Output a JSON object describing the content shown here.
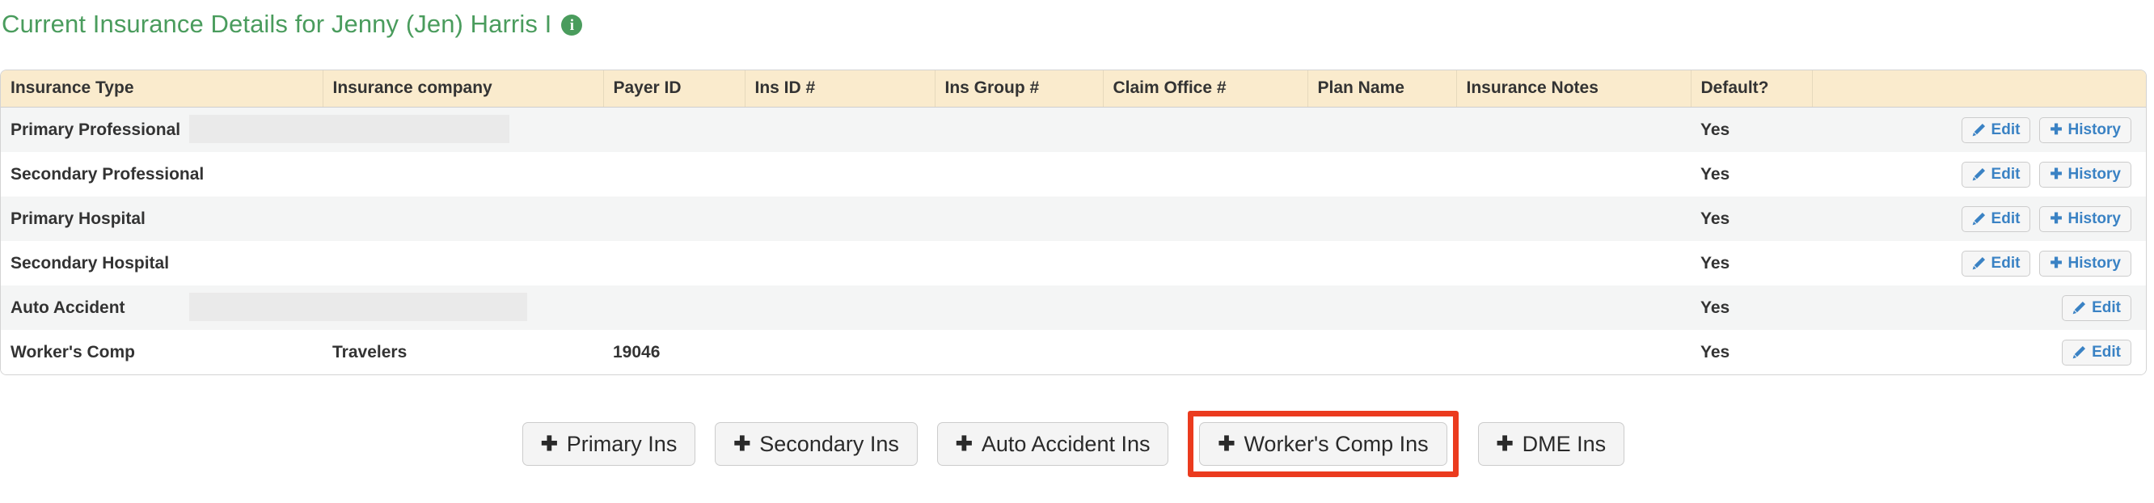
{
  "header": {
    "title": "Current Insurance Details for Jenny (Jen) Harris I",
    "info_icon": "info-icon",
    "title_color": "#4a9c5d"
  },
  "table": {
    "columns": [
      "Insurance Type",
      "Insurance company",
      "Payer ID",
      "Ins ID #",
      "Ins Group #",
      "Claim Office #",
      "Plan Name",
      "Insurance Notes",
      "Default?",
      ""
    ],
    "header_bg": "#faebcd",
    "rows": [
      {
        "insurance_type": "Primary Professional",
        "insurance_company": "",
        "payer_id": "",
        "ins_id": "",
        "ins_group": "",
        "claim_office": "",
        "plan_name": "",
        "insurance_notes": "",
        "default": "Yes",
        "actions": [
          "Edit",
          "History"
        ],
        "redacted": true
      },
      {
        "insurance_type": "Secondary Professional",
        "insurance_company": "",
        "payer_id": "",
        "ins_id": "",
        "ins_group": "",
        "claim_office": "",
        "plan_name": "",
        "insurance_notes": "",
        "default": "Yes",
        "actions": [
          "Edit",
          "History"
        ],
        "redacted": false
      },
      {
        "insurance_type": "Primary Hospital",
        "insurance_company": "",
        "payer_id": "",
        "ins_id": "",
        "ins_group": "",
        "claim_office": "",
        "plan_name": "",
        "insurance_notes": "",
        "default": "Yes",
        "actions": [
          "Edit",
          "History"
        ],
        "redacted": false
      },
      {
        "insurance_type": "Secondary Hospital",
        "insurance_company": "",
        "payer_id": "",
        "ins_id": "",
        "ins_group": "",
        "claim_office": "",
        "plan_name": "",
        "insurance_notes": "",
        "default": "Yes",
        "actions": [
          "Edit",
          "History"
        ],
        "redacted": false
      },
      {
        "insurance_type": "Auto Accident",
        "insurance_company": "",
        "payer_id": "",
        "ins_id": "",
        "ins_group": "",
        "claim_office": "",
        "plan_name": "",
        "insurance_notes": "",
        "default": "Yes",
        "actions": [
          "Edit"
        ],
        "redacted": true
      },
      {
        "insurance_type": "Worker's Comp",
        "insurance_company": "Travelers",
        "payer_id": "19046",
        "ins_id": "",
        "ins_group": "",
        "claim_office": "",
        "plan_name": "",
        "insurance_notes": "",
        "default": "Yes",
        "actions": [
          "Edit"
        ],
        "redacted": false
      }
    ],
    "edit_label": "Edit",
    "history_label": "History"
  },
  "add_buttons": [
    {
      "label": "Primary Ins",
      "highlighted": false
    },
    {
      "label": "Secondary Ins",
      "highlighted": false
    },
    {
      "label": "Auto Accident Ins",
      "highlighted": false
    },
    {
      "label": "Worker's Comp Ins",
      "highlighted": true
    },
    {
      "label": "DME Ins",
      "highlighted": false
    }
  ],
  "highlight_color": "#eb3b1e"
}
